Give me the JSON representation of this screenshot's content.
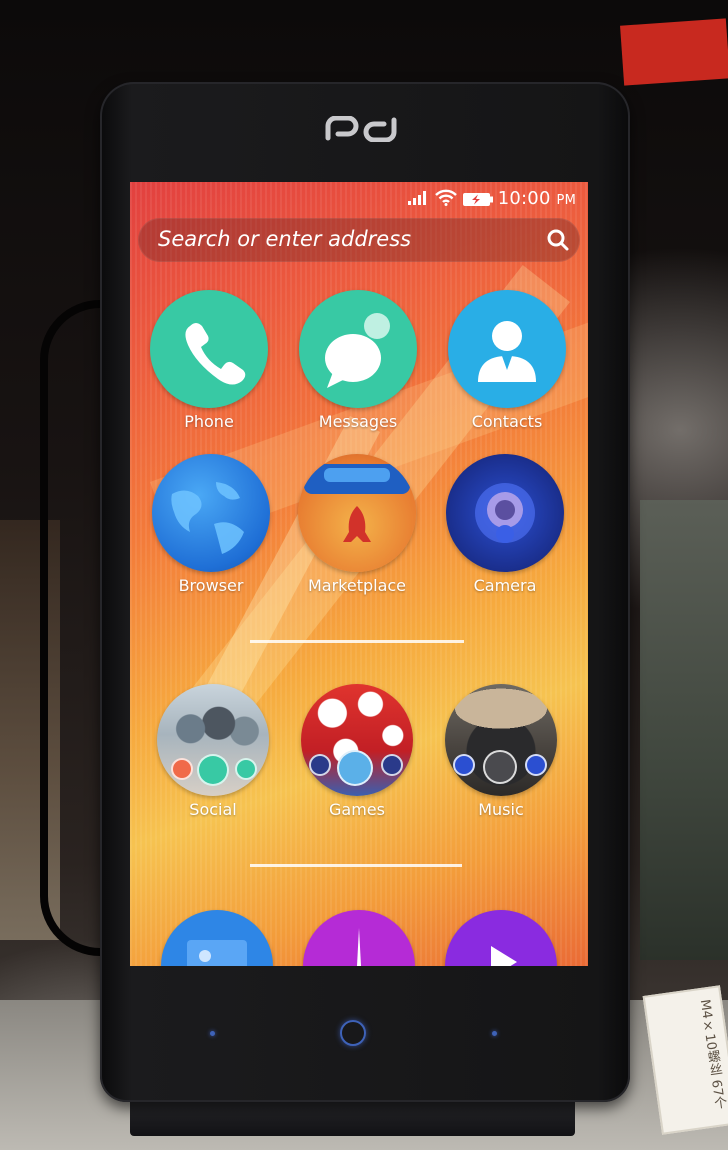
{
  "status_bar": {
    "time": "10:00",
    "meridiem": "PM"
  },
  "search": {
    "placeholder": "Search or enter address"
  },
  "apps": [
    {
      "label": "Phone",
      "icon": "phone-icon",
      "color": "#38c9a4"
    },
    {
      "label": "Messages",
      "icon": "messages-icon",
      "color": "#38c9a4"
    },
    {
      "label": "Contacts",
      "icon": "contacts-icon",
      "color": "#29aee6"
    },
    {
      "label": "Browser",
      "icon": "browser-icon",
      "color": "#1f6fd6"
    },
    {
      "label": "Marketplace",
      "icon": "marketplace-icon",
      "color": "#f0a335"
    },
    {
      "label": "Camera",
      "icon": "camera-icon",
      "color": "#1a2e8c"
    }
  ],
  "collections": [
    {
      "label": "Social",
      "icon": "social-collection-icon"
    },
    {
      "label": "Games",
      "icon": "games-collection-icon"
    },
    {
      "label": "Music",
      "icon": "music-collection-icon"
    }
  ],
  "bottom_row": [
    {
      "icon": "gallery-icon",
      "color": "#2e86e6"
    },
    {
      "icon": "clock-icon",
      "color": "#b52bd6"
    },
    {
      "icon": "video-icon",
      "color": "#8a2be0"
    }
  ],
  "sticker_text": "M4×10螺丝 67个"
}
